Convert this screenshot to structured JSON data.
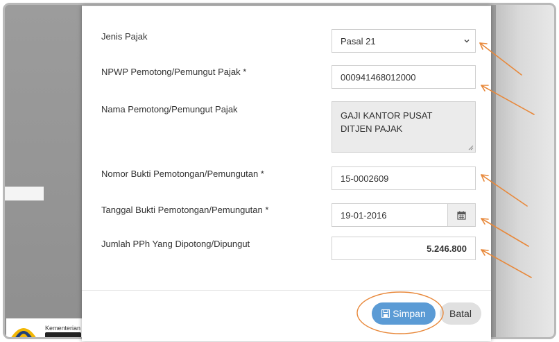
{
  "form": {
    "jenis_pajak": {
      "label": "Jenis Pajak",
      "value": "Pasal 21"
    },
    "npwp": {
      "label": "NPWP Pemotong/Pemungut Pajak *",
      "value": "000941468012000"
    },
    "nama": {
      "label": "Nama Pemotong/Pemungut Pajak",
      "value_line1": "GAJI KANTOR PUSAT",
      "value_line2": "DITJEN PAJAK"
    },
    "nomor_bukti": {
      "label": "Nomor Bukti Pemotongan/Pemungutan *",
      "value": "15-0002609"
    },
    "tanggal_bukti": {
      "label": "Tanggal Bukti Pemotongan/Pemungutan *",
      "value": "19-01-2016"
    },
    "jumlah_pph": {
      "label": "Jumlah PPh Yang Dipotong/Dipungut",
      "value": "5.246.800"
    }
  },
  "buttons": {
    "save_label": "Simpan",
    "cancel_label": "Batal"
  },
  "background": {
    "logo_text": "Kementerian Ke"
  },
  "colors": {
    "save_button": "#5b9bd5",
    "annotation": "#e8883a"
  },
  "icons": [
    "chevron-down-icon",
    "calendar-icon",
    "save-icon",
    "resize-grip-icon"
  ]
}
